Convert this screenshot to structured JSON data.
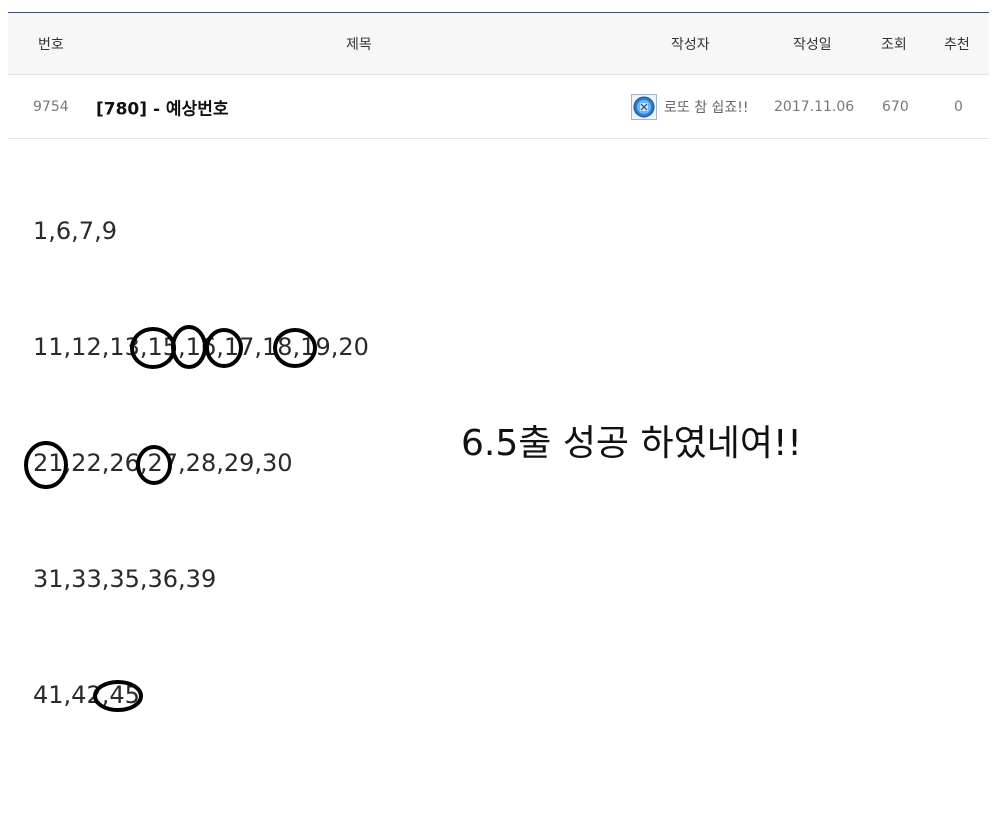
{
  "table": {
    "headers": {
      "number": "번호",
      "title": "제목",
      "author": "작성자",
      "date": "작성일",
      "views": "조회",
      "recommend": "추천"
    },
    "row": {
      "number": "9754",
      "title": "[780] - 예상번호",
      "author_icon": "member-level-icon",
      "author": "로또 참 쉽죠!!",
      "date": "2017.11.06",
      "views": "670",
      "recommend": "0"
    }
  },
  "post": {
    "lines": [
      "1,6,7,9",
      "11,12,13,15,16,17,18,19,20",
      "21,22,26,27,28,29,30",
      "31,33,35,36,39",
      "41,42,45"
    ],
    "circled_numbers": [
      "15",
      "16",
      "17",
      "19",
      "21",
      "27",
      "45"
    ],
    "circle_color": "#000000",
    "message": "6.5출 성공 하였네여!!"
  }
}
